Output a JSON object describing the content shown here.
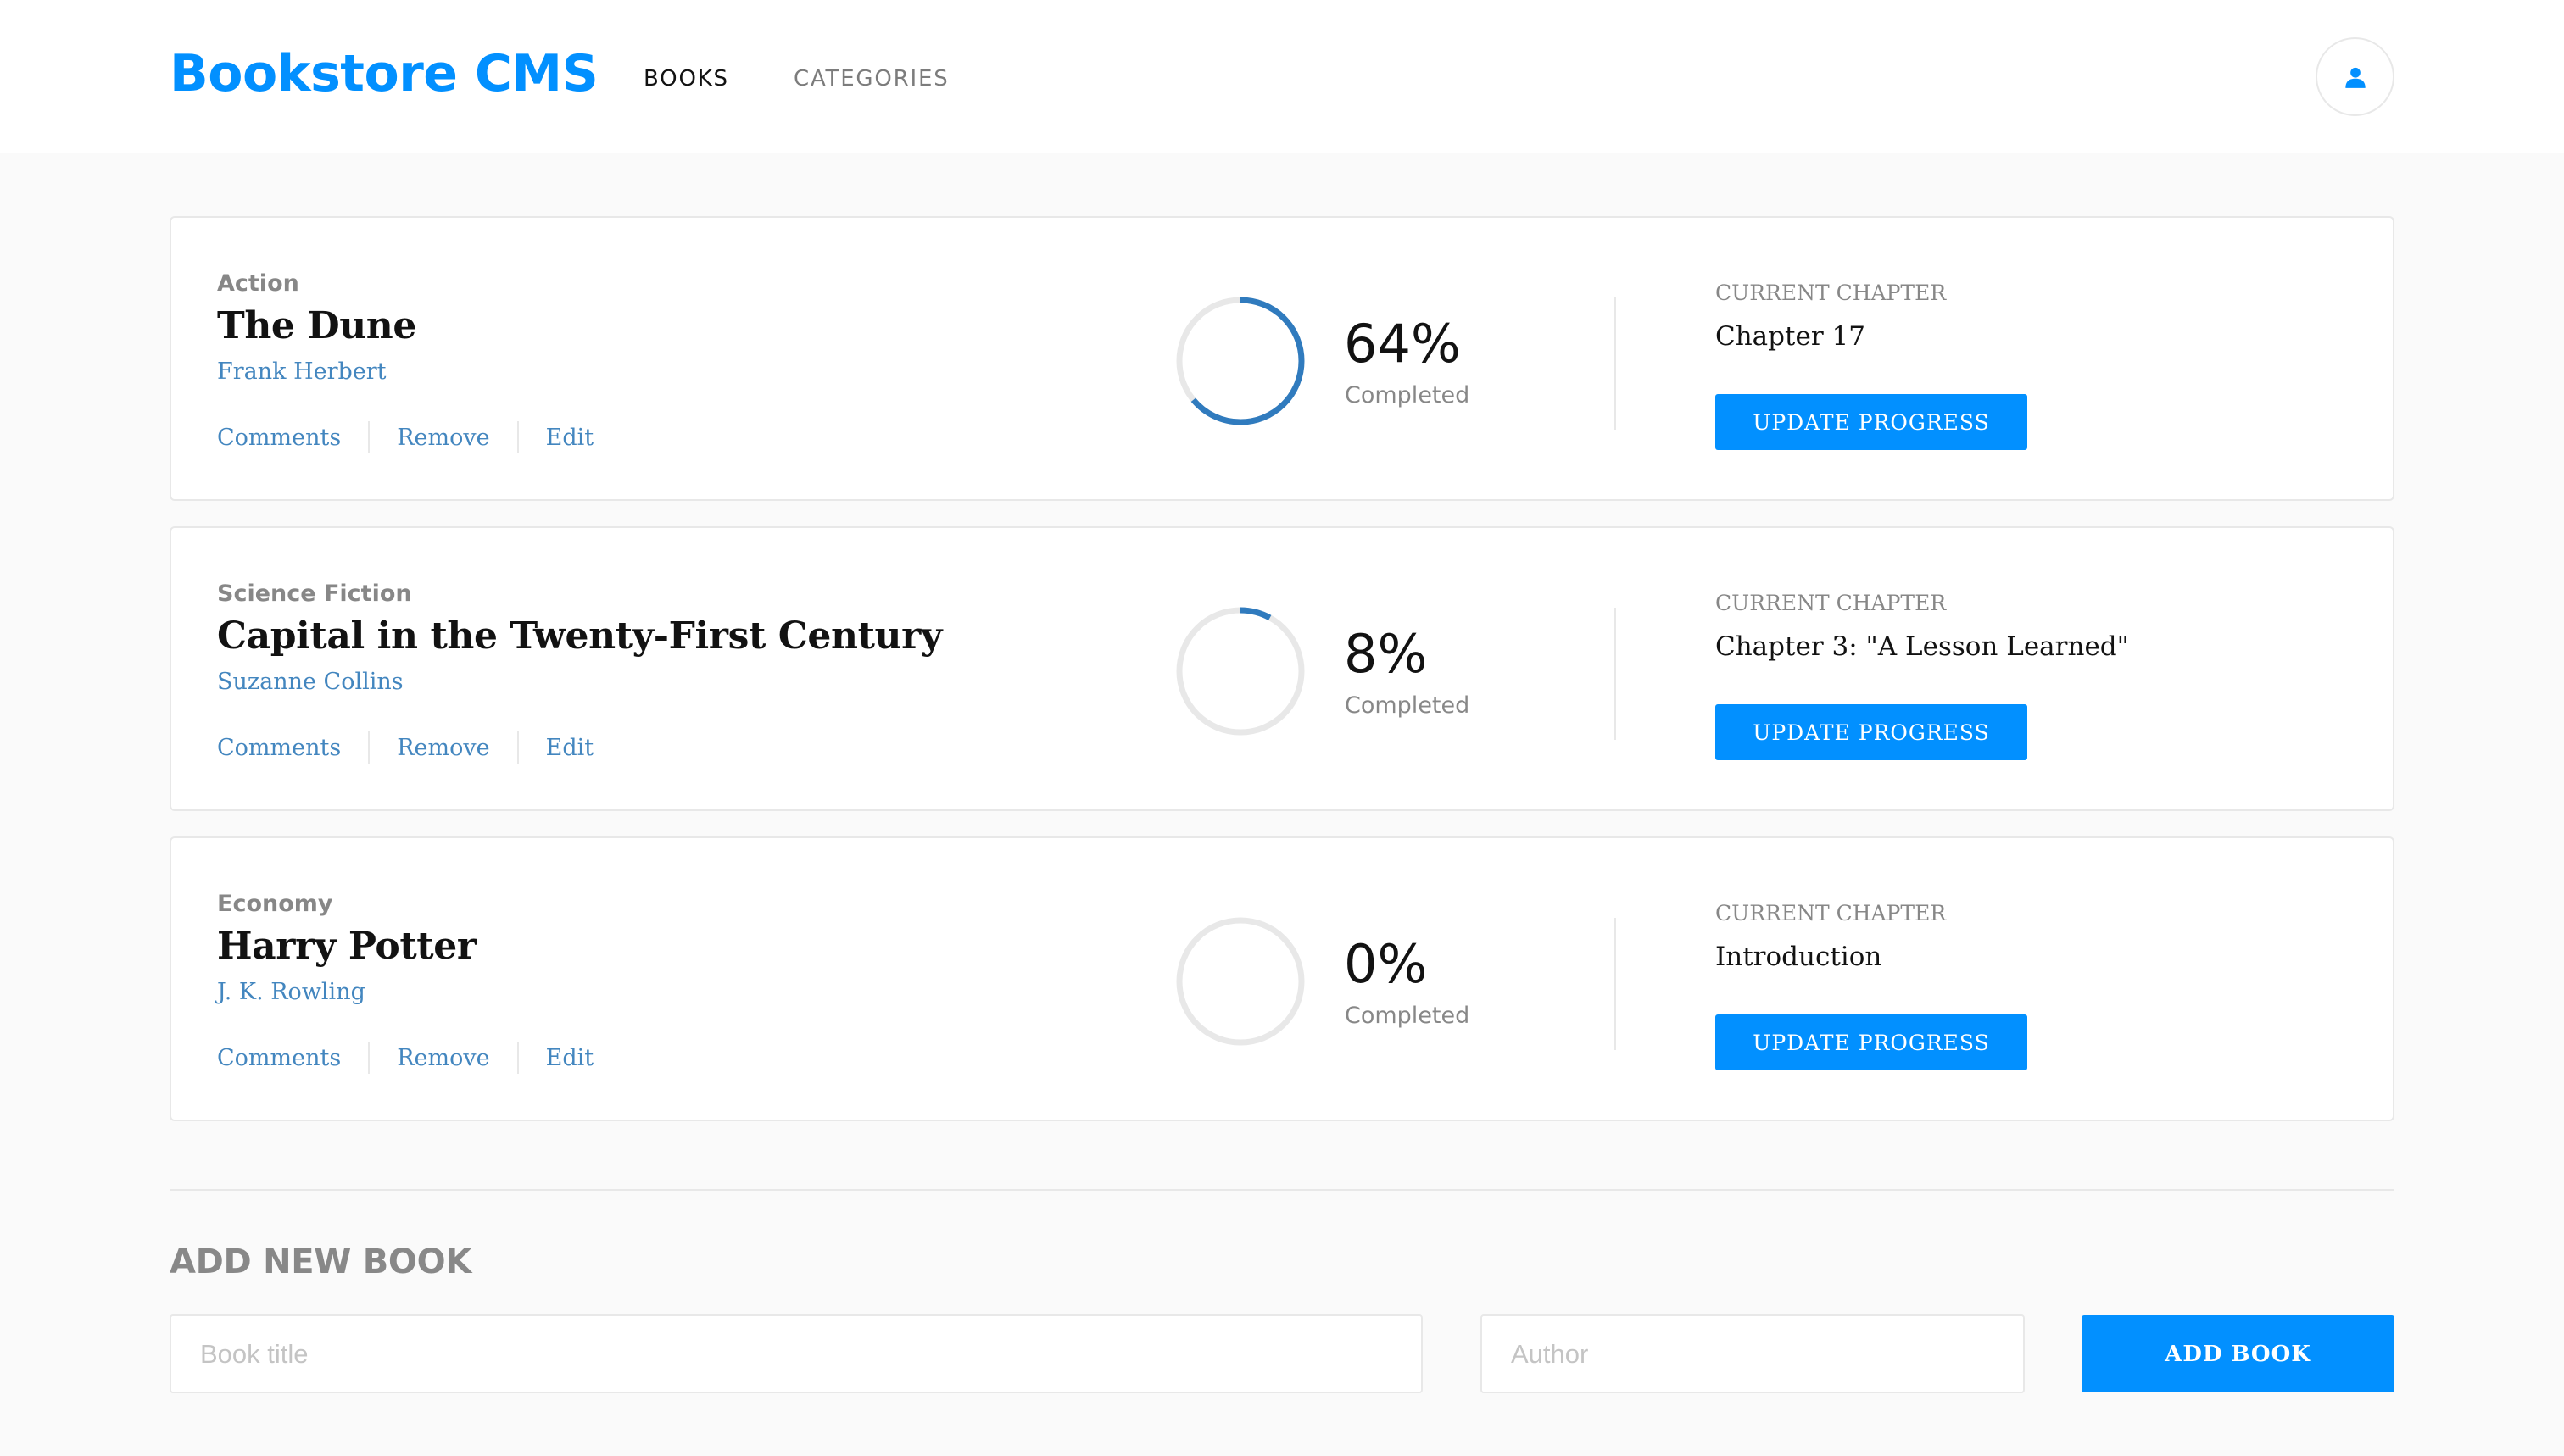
{
  "header": {
    "logo": "Bookstore CMS",
    "nav": [
      {
        "label": "BOOKS"
      },
      {
        "label": "CATEGORIES"
      }
    ],
    "avatar_icon": "user-icon"
  },
  "colors": {
    "accent": "#0290ff",
    "link": "#4386bf",
    "ring_track": "#e8e8e8",
    "ring_fill": "#307bbe"
  },
  "books": [
    {
      "category": "Action",
      "title": "The Dune",
      "author": "Frank Herbert",
      "actions": [
        "Comments",
        "Remove",
        "Edit"
      ],
      "progress": 0.64,
      "percent_text": "64%",
      "completed_label": "Completed",
      "chapter_label": "CURRENT CHAPTER",
      "chapter": "Chapter 17",
      "update_label": "UPDATE PROGRESS"
    },
    {
      "category": "Science Fiction",
      "title": "Capital in the Twenty-First Century",
      "author": "Suzanne Collins",
      "actions": [
        "Comments",
        "Remove",
        "Edit"
      ],
      "progress": 0.08,
      "percent_text": "8%",
      "completed_label": "Completed",
      "chapter_label": "CURRENT CHAPTER",
      "chapter": "Chapter 3: \"A Lesson Learned\"",
      "update_label": "UPDATE PROGRESS"
    },
    {
      "category": "Economy",
      "title": "Harry Potter",
      "author": "J. K. Rowling",
      "actions": [
        "Comments",
        "Remove",
        "Edit"
      ],
      "progress": 0,
      "percent_text": "0%",
      "completed_label": "Completed",
      "chapter_label": "CURRENT CHAPTER",
      "chapter": "Introduction",
      "update_label": "UPDATE PROGRESS"
    }
  ],
  "add_book": {
    "heading": "ADD NEW BOOK",
    "title_placeholder": "Book title",
    "author_placeholder": "Author",
    "button_label": "ADD BOOK"
  }
}
